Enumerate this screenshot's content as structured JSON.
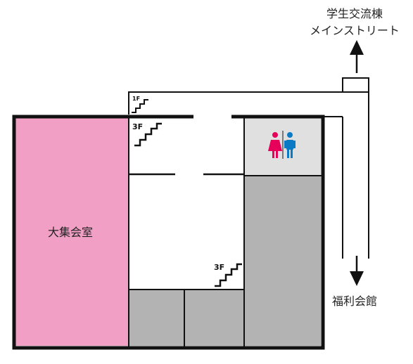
{
  "labels": {
    "top_line1": "学生交流棟",
    "top_line2": "メインストリート",
    "hall": "大集会室",
    "bottom": "福利会館"
  },
  "stairs": {
    "upper_small": "1F",
    "upper_3f": "3F",
    "lower_3f": "3F"
  },
  "restroom": {
    "female_icon": "female-restroom-icon",
    "male_icon": "male-restroom-icon"
  },
  "colors": {
    "hall": "#f29fc5",
    "gray_room": "#b3b3b3",
    "restroom_bg": "#e0e0e0",
    "female": "#e6005a",
    "male": "#0b7ac4",
    "wall": "#111111"
  }
}
